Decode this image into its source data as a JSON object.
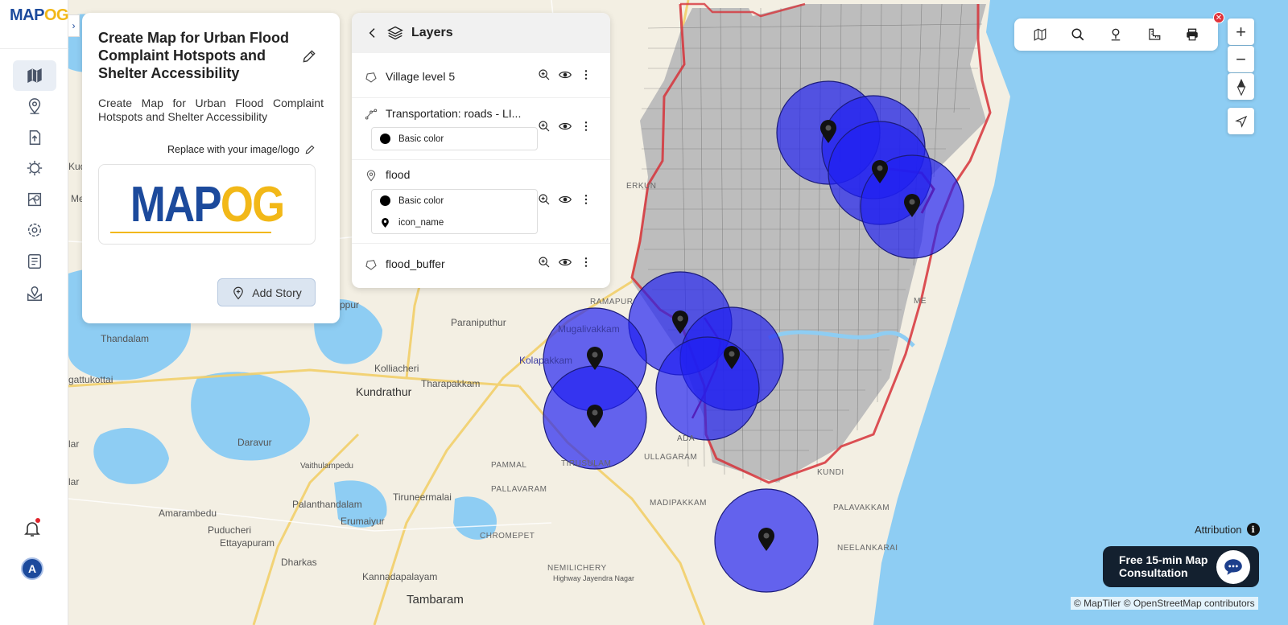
{
  "app": {
    "brand": "MAPOG",
    "brand_head": "MAP",
    "brand_tail": "OG",
    "avatar_initial": "A"
  },
  "sidebar": {
    "items": [
      {
        "name": "map-icon"
      },
      {
        "name": "location-pin-icon"
      },
      {
        "name": "upload-icon"
      },
      {
        "name": "analysis-gear-icon"
      },
      {
        "name": "map-layers-icon"
      },
      {
        "name": "settings-icon"
      },
      {
        "name": "data-table-icon"
      },
      {
        "name": "map-share-icon"
      }
    ]
  },
  "story": {
    "title": "Create Map for Urban Flood Complaint Hotspots and Shelter Accessibility",
    "description": "Create Map for Urban Flood Complaint Hotspots and Shelter Accessibility",
    "replace_logo_label": "Replace with your image/logo",
    "logo_text": "MAPOG",
    "add_story_label": "Add Story"
  },
  "layers_panel": {
    "title": "Layers",
    "layers": [
      {
        "name": "Village level 5",
        "icon": "polygon-icon"
      },
      {
        "name": "Transportation: roads - LI...",
        "icon": "line-icon",
        "legend": [
          {
            "type": "dot",
            "label": "Basic color"
          }
        ]
      },
      {
        "name": "flood",
        "icon": "point-icon",
        "legend": [
          {
            "type": "dot",
            "label": "Basic color"
          },
          {
            "type": "pin",
            "label": "icon_name"
          }
        ]
      },
      {
        "name": "flood_buffer",
        "icon": "polygon-icon"
      }
    ]
  },
  "map": {
    "places": [
      "Mugalivakkam",
      "Kolapakkam",
      "Kolliacheri",
      "Kundrathur",
      "Tharapakkam",
      "Paraniputhur",
      "Thandalam",
      "Daravur",
      "Vaithulampedu",
      "Palanthandalam",
      "Tiruneermalai",
      "Amarambedu",
      "Erumaiyur",
      "Puducheri",
      "Ettayapuram",
      "Dharkas",
      "Kannadapalayam",
      "Tambaram",
      "PAMMAL",
      "PALLAVARAM",
      "CHROMEPET",
      "NEMILICHERY",
      "MADIPAKKAM",
      "ULLAGARAM",
      "TIRUSULAM",
      "RAMAPUR",
      "PALAVAKKAM",
      "NEELANKARAI",
      "Highway Jayendra Nagar",
      "ppur",
      "gattukottai",
      "Kud",
      "Me",
      "lar",
      "lar",
      "KUNDI",
      "ADA",
      "ME",
      "ERKUN"
    ],
    "colors": {
      "water": "#8ecdf3",
      "buffer": "#1f1ff2",
      "boundary": "#d6333a",
      "land": "#f3efe3"
    }
  },
  "toolbar": {
    "icons": [
      "map-view-icon",
      "search-icon",
      "pin-drop-icon",
      "measure-icon",
      "print-icon"
    ]
  },
  "controls": {
    "zoom_in": "+",
    "zoom_out": "−"
  },
  "attribution": {
    "label": "Attribution",
    "info": "i",
    "credits": "© MapTiler © OpenStreetMap contributors"
  },
  "consult": {
    "line1": "Free 15-min Map",
    "line2": "Consultation"
  }
}
